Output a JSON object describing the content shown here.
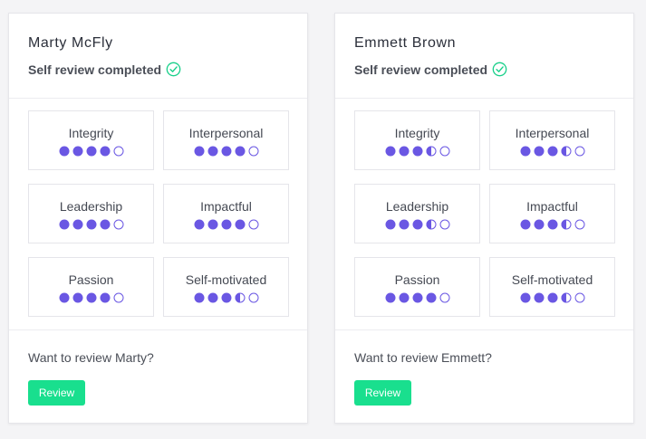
{
  "colors": {
    "accent": "#6a57e3",
    "check": "#19d08a",
    "button": "#19df8e"
  },
  "icons": {
    "status": "check-circle-icon",
    "rating_full": "filled-circle-icon",
    "rating_half": "half-circle-icon",
    "rating_empty": "empty-circle-icon"
  },
  "cards": [
    {
      "name": "Marty McFly",
      "status": "Self review completed",
      "prompt": "Want to review Marty?",
      "button_label": "Review",
      "skills": [
        {
          "label": "Integrity",
          "rating": 4
        },
        {
          "label": "Interpersonal",
          "rating": 4
        },
        {
          "label": "Leadership",
          "rating": 4
        },
        {
          "label": "Impactful",
          "rating": 4
        },
        {
          "label": "Passion",
          "rating": 4
        },
        {
          "label": "Self-motivated",
          "rating": 3.5
        }
      ]
    },
    {
      "name": "Emmett Brown",
      "status": "Self review completed",
      "prompt": "Want to review Emmett?",
      "button_label": "Review",
      "skills": [
        {
          "label": "Integrity",
          "rating": 3.5
        },
        {
          "label": "Interpersonal",
          "rating": 3.5
        },
        {
          "label": "Leadership",
          "rating": 3.5
        },
        {
          "label": "Impactful",
          "rating": 3.5
        },
        {
          "label": "Passion",
          "rating": 4
        },
        {
          "label": "Self-motivated",
          "rating": 3.5
        }
      ]
    }
  ]
}
